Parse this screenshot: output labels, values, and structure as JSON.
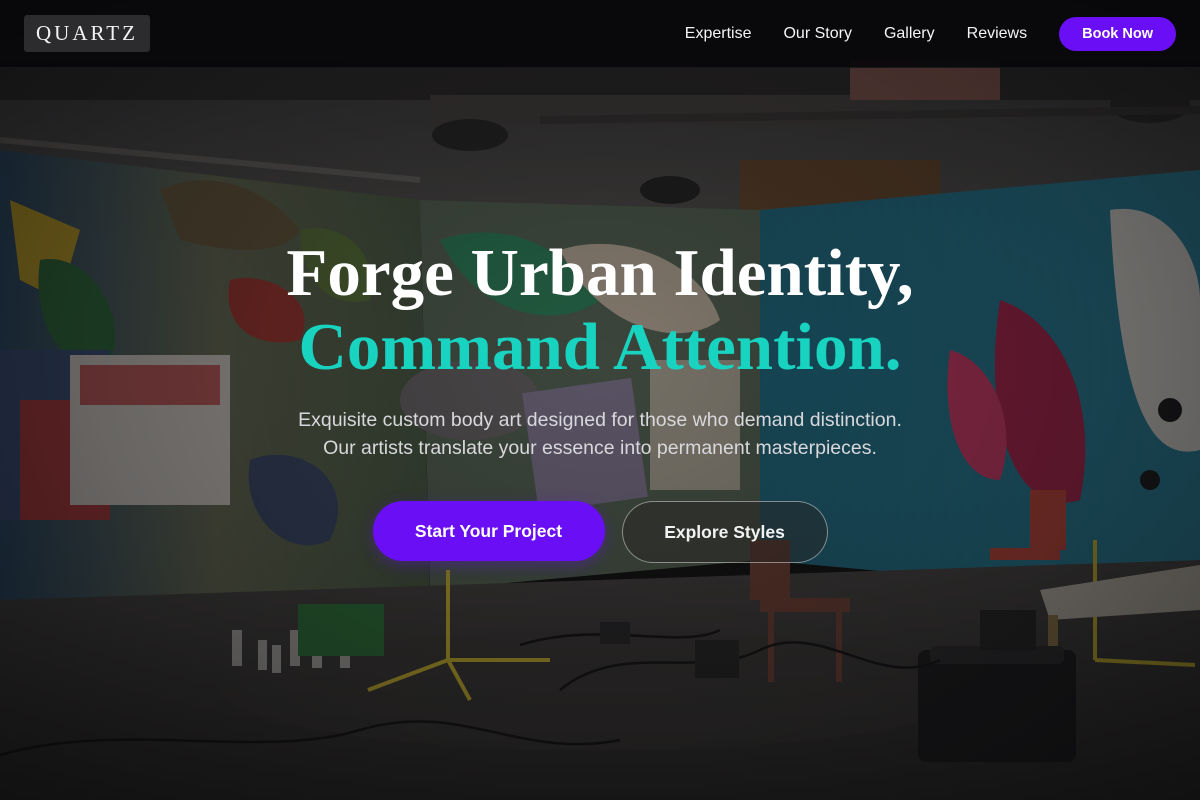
{
  "brand": {
    "logo": "QUARTZ"
  },
  "nav": {
    "links": [
      "Expertise",
      "Our Story",
      "Gallery",
      "Reviews"
    ],
    "cta": "Book Now"
  },
  "hero": {
    "headline_line1": "Forge Urban Identity,",
    "headline_line2": "Command Attention.",
    "subtitle_line1": "Exquisite custom body art designed for those who demand distinction.",
    "subtitle_line2": "Our artists translate your essence into permanent masterpieces.",
    "primary_cta": "Start Your Project",
    "secondary_cta": "Explore Styles",
    "background_image": "graffiti-covered abandoned studio interior"
  },
  "colors": {
    "accent_purple": "#6a0ff5",
    "accent_teal": "#19d3c1",
    "nav_background": "#0a0a0c",
    "text_white": "#ffffff"
  }
}
